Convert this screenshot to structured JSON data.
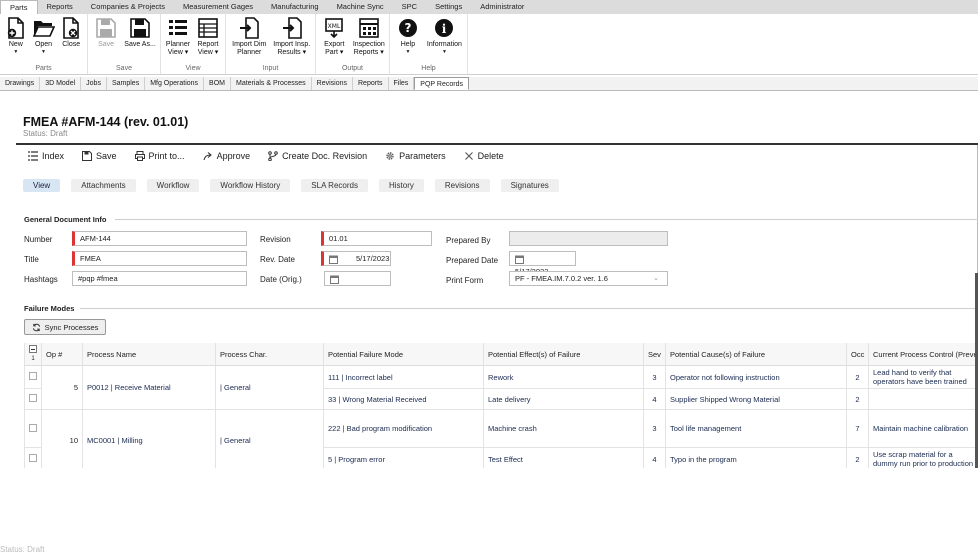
{
  "menu_tabs": [
    "Parts",
    "Reports",
    "Companies & Projects",
    "Measurement Gages",
    "Manufacturing",
    "Machine Sync",
    "SPC",
    "Settings",
    "Administrator"
  ],
  "ribbon": {
    "groups": [
      {
        "name": "Parts",
        "buttons": [
          {
            "label": "New",
            "icon": "new-doc-icon"
          },
          {
            "label": "Open",
            "icon": "folder-open-icon"
          },
          {
            "label": "Close",
            "icon": "close-doc-icon"
          }
        ]
      },
      {
        "name": "Save",
        "buttons": [
          {
            "label": "Save",
            "icon": "save-icon"
          },
          {
            "label": "Save As...",
            "icon": "save-as-icon"
          }
        ]
      },
      {
        "name": "View",
        "buttons": [
          {
            "label1": "Planner",
            "label2": "View",
            "icon": "planner-view-icon"
          },
          {
            "label1": "Report",
            "label2": "View",
            "icon": "report-view-icon"
          }
        ]
      },
      {
        "name": "Input",
        "buttons": [
          {
            "label1": "Import Dim",
            "label2": "Planner",
            "icon": "import-dim-icon"
          },
          {
            "label1": "Import Insp.",
            "label2": "Results",
            "icon": "import-insp-icon"
          }
        ]
      },
      {
        "name": "Output",
        "buttons": [
          {
            "label1": "Export",
            "label2": "Part",
            "icon": "export-part-icon"
          },
          {
            "label1": "Inspection",
            "label2": "Reports",
            "icon": "inspection-reports-icon"
          }
        ]
      },
      {
        "name": "Help",
        "buttons": [
          {
            "label": "Help",
            "icon": "help-icon"
          },
          {
            "label": "Information",
            "icon": "information-icon"
          }
        ]
      }
    ]
  },
  "sub_tabs": [
    "Drawings",
    "3D Model",
    "Jobs",
    "Samples",
    "Mfg Operations",
    "BOM",
    "Materials & Processes",
    "Revisions",
    "Reports",
    "Files",
    "PQP Records"
  ],
  "document": {
    "title": "FMEA #AFM-144 (rev. 01.01)",
    "status": "Status: Draft"
  },
  "actions": [
    "Index",
    "Save",
    "Print to...",
    "Approve",
    "Create Doc. Revision",
    "Parameters",
    "Delete"
  ],
  "view_tabs": [
    "View",
    "Attachments",
    "Workflow",
    "Workflow History",
    "SLA Records",
    "History",
    "Revisions",
    "Signatures"
  ],
  "general": {
    "section": "General Document Info",
    "number_label": "Number",
    "number_value": "AFM-144",
    "title_label": "Title",
    "title_value": "FMEA",
    "hashtags_label": "Hashtags",
    "hashtags_value": "#pqp #fmea",
    "revision_label": "Revision",
    "revision_value": "01.01",
    "rev_date_label": "Rev. Date",
    "rev_date_value": "5/17/2023",
    "date_orig_label": "Date (Orig.)",
    "date_orig_value": "",
    "prepared_by_label": "Prepared By",
    "prepared_by_value": "",
    "prepared_date_label": "Prepared Date",
    "prepared_date_value": "5/17/2023",
    "print_form_label": "Print Form",
    "print_form_value": "PF - FMEA.IM.7.0.2 ver. 1.6"
  },
  "failure": {
    "section": "Failure Modes",
    "sync_label": "Sync Processes",
    "select_count": "1",
    "columns": [
      "Op #",
      "Process Name",
      "Process Char.",
      "Potential Failure Mode",
      "Potential Effect(s) of Failure",
      "Sev",
      "Potential Cause(s) of Failure",
      "Occ",
      "Current Process Control (Prevention)"
    ],
    "rows": [
      {
        "op": "5",
        "process": "P0012 | Receive Material",
        "char": "| General",
        "mode": "111 | Incorrect label",
        "effect": "Rework",
        "sev": "3",
        "cause": "Operator not following instruction",
        "occ": "2",
        "control": "Lead hand to verify that operators have been trained"
      },
      {
        "op": "",
        "process": "",
        "char": "",
        "mode": "33 | Wrong Material Received",
        "effect": "Late delivery",
        "sev": "4",
        "cause": "Supplier Shipped Wrong Material",
        "occ": "2",
        "control": ""
      },
      {
        "op": "10",
        "process": "MC0001 | Milling",
        "char": "| General",
        "mode": "222 | Bad program modification",
        "effect": "Machine crash",
        "sev": "3",
        "cause": "Tool life management",
        "occ": "7",
        "control": "Maintain machine calibration"
      },
      {
        "op": "",
        "process": "",
        "char": "",
        "mode": "5 | Program error",
        "effect": "Test Effect",
        "sev": "4",
        "cause": "Typo in the program",
        "occ": "2",
        "control": "Use scrap material for a dummy run prior to production"
      }
    ]
  },
  "footer_text": "Status: Draft"
}
